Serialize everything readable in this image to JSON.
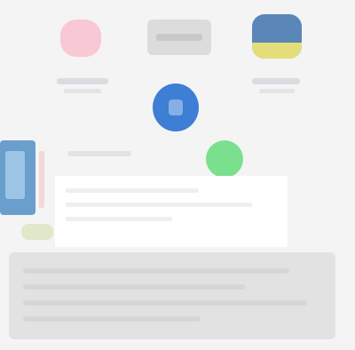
{
  "screen": {
    "background": "#f4f4f4",
    "accent_blue": "#3e7ed4",
    "accent_green": "#7be08e",
    "accent_pink": "#f8c8d4"
  },
  "apps": [
    {
      "icon": "pink-app-icon",
      "label": ""
    },
    {
      "icon": "gray-app-icon",
      "label": ""
    },
    {
      "icon": "flag-app-icon",
      "label": ""
    }
  ],
  "content": {
    "section_label": "",
    "panel_text": ""
  }
}
